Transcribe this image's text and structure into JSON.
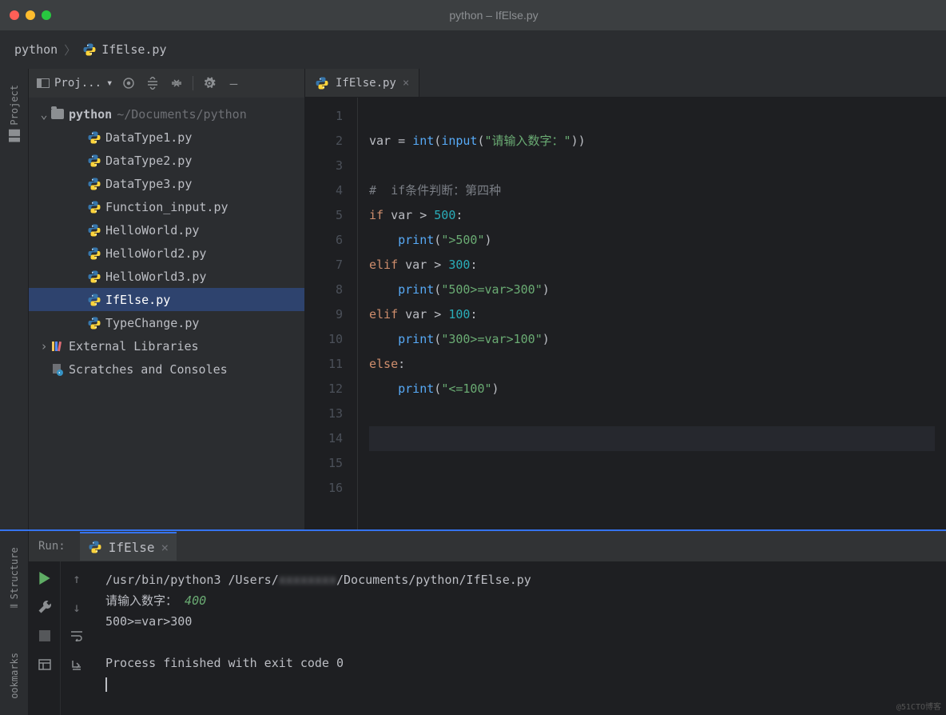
{
  "titlebar": {
    "title": "python – IfElse.py"
  },
  "breadcrumb": {
    "items": [
      "python",
      "IfElse.py"
    ]
  },
  "leftRail": {
    "project": "Project"
  },
  "projectPanel": {
    "title": "Proj...",
    "root": {
      "name": "python",
      "path": "~/Documents/python"
    },
    "files": [
      {
        "name": "DataType1.py"
      },
      {
        "name": "DataType2.py"
      },
      {
        "name": "DataType3.py"
      },
      {
        "name": "Function_input.py"
      },
      {
        "name": "HelloWorld.py"
      },
      {
        "name": "HelloWorld2.py"
      },
      {
        "name": "HelloWorld3.py"
      },
      {
        "name": "IfElse.py",
        "selected": true
      },
      {
        "name": "TypeChange.py"
      }
    ],
    "externalLibs": "External Libraries",
    "scratches": "Scratches and Consoles"
  },
  "editor": {
    "tab": "IfElse.py",
    "lines": 16,
    "currentLine": 14,
    "code": {
      "l2": {
        "var": "var",
        "eq": " = ",
        "int": "int",
        "input": "input",
        "prompt": "\"请输入数字：\""
      },
      "l4": "#  if条件判断：第四种",
      "l5": {
        "if": "if",
        "var": "var",
        "gt": " > ",
        "n": "500",
        "c": ":"
      },
      "l6": {
        "print": "print",
        "s": "\">500\""
      },
      "l7": {
        "elif": "elif",
        "var": "var",
        "gt": " > ",
        "n": "300",
        "c": ":"
      },
      "l8": {
        "print": "print",
        "s": "\"500>=var>300\""
      },
      "l9": {
        "elif": "elif",
        "var": "var",
        "gt": " > ",
        "n": "100",
        "c": ":"
      },
      "l10": {
        "print": "print",
        "s": "\"300>=var>100\""
      },
      "l11": {
        "else": "else",
        "c": ":"
      },
      "l12": {
        "print": "print",
        "s": "\"<=100\""
      }
    }
  },
  "run": {
    "label": "Run:",
    "tab": "IfElse",
    "console": {
      "cmd1": "/usr/bin/python3 /Users/",
      "cmd2": "/Documents/python/IfElse.py",
      "prompt": "请输入数字：",
      "input": "400",
      "output": "500>=var>300",
      "exit": "Process finished with exit code 0"
    }
  },
  "bottomRail": {
    "structure": "Structure",
    "bookmarks": "ookmarks"
  },
  "watermark": "@51CTO博客"
}
